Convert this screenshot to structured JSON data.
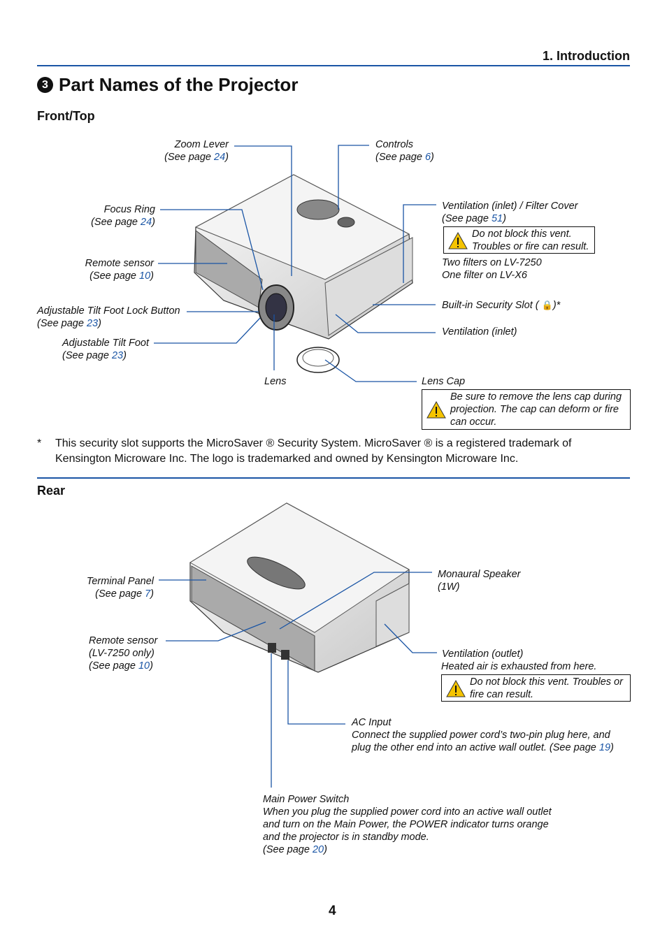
{
  "header": {
    "section": "1. Introduction"
  },
  "title": {
    "number": "3",
    "text": "Part Names of the Projector"
  },
  "front": {
    "heading": "Front/Top",
    "zoom_lever": {
      "name": "Zoom Lever",
      "see": "(See page ",
      "page": "24",
      "close": ")"
    },
    "controls": {
      "name": "Controls",
      "see": "(See page ",
      "page": "6",
      "close": ")"
    },
    "focus_ring": {
      "name": "Focus Ring",
      "see": "(See page ",
      "page": "24",
      "close": ")"
    },
    "remote_sensor": {
      "name": "Remote sensor",
      "see": "(See page ",
      "page": "10",
      "close": ")"
    },
    "tilt_lock": {
      "name": "Adjustable Tilt Foot Lock Button",
      "see": "(See page ",
      "page": "23",
      "close": ")"
    },
    "tilt_foot": {
      "name": "Adjustable Tilt Foot",
      "see": "(See page ",
      "page": "23",
      "close": ")"
    },
    "lens": "Lens",
    "vent_filter": {
      "name": "Ventilation (inlet) / Filter Cover",
      "see": "(See page ",
      "page": "51",
      "close": ")",
      "warning": [
        "Do not block this vent.",
        "Troubles or fire can result."
      ],
      "note1": "Two filters on LV-7250",
      "note2": "One filter on LV-X6"
    },
    "security_slot": {
      "name": "Built-in Security Slot (",
      "close": ")*"
    },
    "vent_inlet": "Ventilation (inlet)",
    "lens_cap": {
      "name": "Lens Cap",
      "warning": "Be sure to remove the lens cap during projection. The cap can deform or fire can occur."
    },
    "footnote_mark": "*",
    "footnote": "This security slot supports the MicroSaver ® Security System. MicroSaver ® is a registered trademark of Kensington Microware Inc. The logo is trademarked and owned by Kensington Microware Inc."
  },
  "rear": {
    "heading": "Rear",
    "terminal": {
      "name": "Terminal Panel",
      "see": "(See page ",
      "page": "7",
      "close": ")"
    },
    "remote_sensor": {
      "name": "Remote sensor",
      "note": "(LV-7250 only)",
      "see": "(See page ",
      "page": "10",
      "close": ")"
    },
    "speaker": {
      "name": "Monaural Speaker",
      "note": "(1W)"
    },
    "vent_outlet": {
      "name": "Ventilation (outlet)",
      "desc": "Heated air is exhausted from here.",
      "warning": "Do not block this vent. Troubles or fire can result."
    },
    "ac_input": {
      "name": "AC Input",
      "desc1": "Connect the supplied power cord’s two-pin plug here, and",
      "desc2": "plug the other end into an active wall outlet. (See page ",
      "page": "19",
      "close": ")"
    },
    "power_switch": {
      "name": "Main Power Switch",
      "d1": "When you plug the supplied power cord into an active wall outlet",
      "d2": "and turn on the Main Power, the POWER indicator turns orange",
      "d3": "and the projector is in standby mode.",
      "see": "(See page ",
      "page": "20",
      "close": ")"
    }
  },
  "page_number": "4",
  "colors": {
    "accent": "#1a55a5",
    "warning": "#f5c400"
  }
}
